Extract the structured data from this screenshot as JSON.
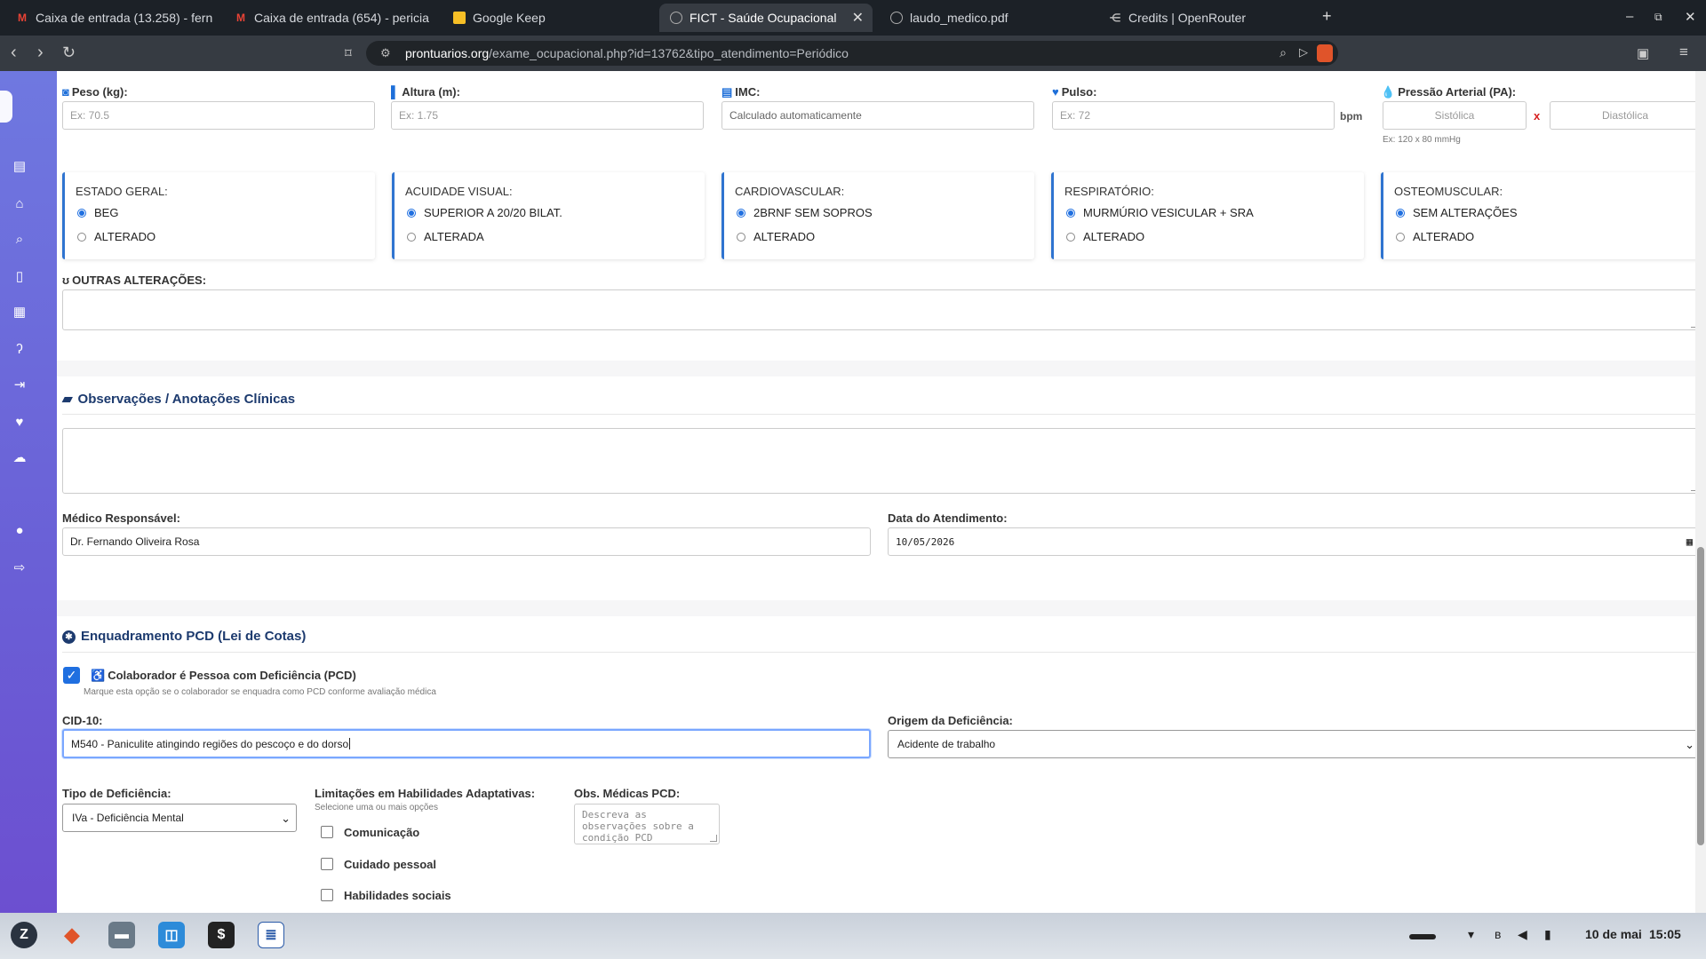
{
  "browser": {
    "tabs": [
      {
        "title": "Caixa de entrada (13.258) - fern",
        "icon": "gmail-icon"
      },
      {
        "title": "Caixa de entrada (654) - pericia",
        "icon": "gmail-icon"
      },
      {
        "title": "Google Keep",
        "icon": "keep-icon"
      },
      {
        "title": "FICT - Saúde Ocupacional",
        "icon": "globe-icon",
        "active": true
      },
      {
        "title": "laudo_medico.pdf",
        "icon": "globe-icon"
      },
      {
        "title": "Credits | OpenRouter",
        "icon": "openrouter-icon"
      }
    ],
    "url_host": "prontuarios.org",
    "url_path": "/exame_ocupacional.php?id=13762&tipo_atendimento=Periódico"
  },
  "vitals": {
    "peso_label": "Peso (kg):",
    "peso_placeholder": "Ex: 70.5",
    "altura_label": "Altura (m):",
    "altura_placeholder": "Ex: 1.75",
    "imc_label": "IMC:",
    "imc_placeholder": "Calculado automaticamente",
    "pulso_label": "Pulso:",
    "pulso_placeholder": "Ex: 72",
    "pulso_unit": "bpm",
    "pa_label": "Pressão Arterial (PA):",
    "pa_sist_placeholder": "Sistólica",
    "pa_sep": "x",
    "pa_diast_placeholder": "Diastólica",
    "pa_hint": "Ex: 120 x 80 mmHg"
  },
  "exam_cards": [
    {
      "title": "ESTADO GERAL:",
      "opt1": "BEG",
      "opt2": "ALTERADO"
    },
    {
      "title": "ACUIDADE VISUAL:",
      "opt1": "SUPERIOR A 20/20 BILAT.",
      "opt2": "ALTERADA"
    },
    {
      "title": "CARDIOVASCULAR:",
      "opt1": "2BRNF SEM SOPROS",
      "opt2": "ALTERADO"
    },
    {
      "title": "RESPIRATÓRIO:",
      "opt1": "MURMÚRIO VESICULAR + SRA",
      "opt2": "ALTERADO"
    },
    {
      "title": "OSTEOMUSCULAR:",
      "opt1": "SEM ALTERAÇÕES",
      "opt2": "ALTERADO"
    }
  ],
  "outras": {
    "label": "OUTRAS ALTERAÇÕES:"
  },
  "obs": {
    "title": "Observações / Anotações Clínicas"
  },
  "medico": {
    "label": "Médico Responsável:",
    "value": "Dr. Fernando Oliveira Rosa"
  },
  "data_atend": {
    "label": "Data do Atendimento:",
    "value": "10/05/2026"
  },
  "pcd": {
    "title": "Enquadramento PCD (Lei de Cotas)",
    "checkbox_label": "Colaborador é Pessoa com Deficiência (PCD)",
    "checkbox_hint": "Marque esta opção se o colaborador se enquadra como PCD conforme avaliação médica",
    "cid_label": "CID-10:",
    "cid_value": "M540 - Paniculite atingindo regiões do pescoço e do dorso",
    "origem_label": "Origem da Deficiência:",
    "origem_value": "Acidente de trabalho",
    "tipo_label": "Tipo de Deficiência:",
    "tipo_value": "IVa - Deficiência Mental",
    "limitacoes_label": "Limitações em Habilidades Adaptativas:",
    "limitacoes_hint": "Selecione uma ou mais opções",
    "limitacoes": [
      "Comunicação",
      "Cuidado pessoal",
      "Habilidades sociais"
    ],
    "obs_label": "Obs. Médicas PCD:",
    "obs_placeholder": "Descreva as observações sobre a condição PCD"
  },
  "taskbar": {
    "date": "10 de mai",
    "time": "15:05"
  }
}
